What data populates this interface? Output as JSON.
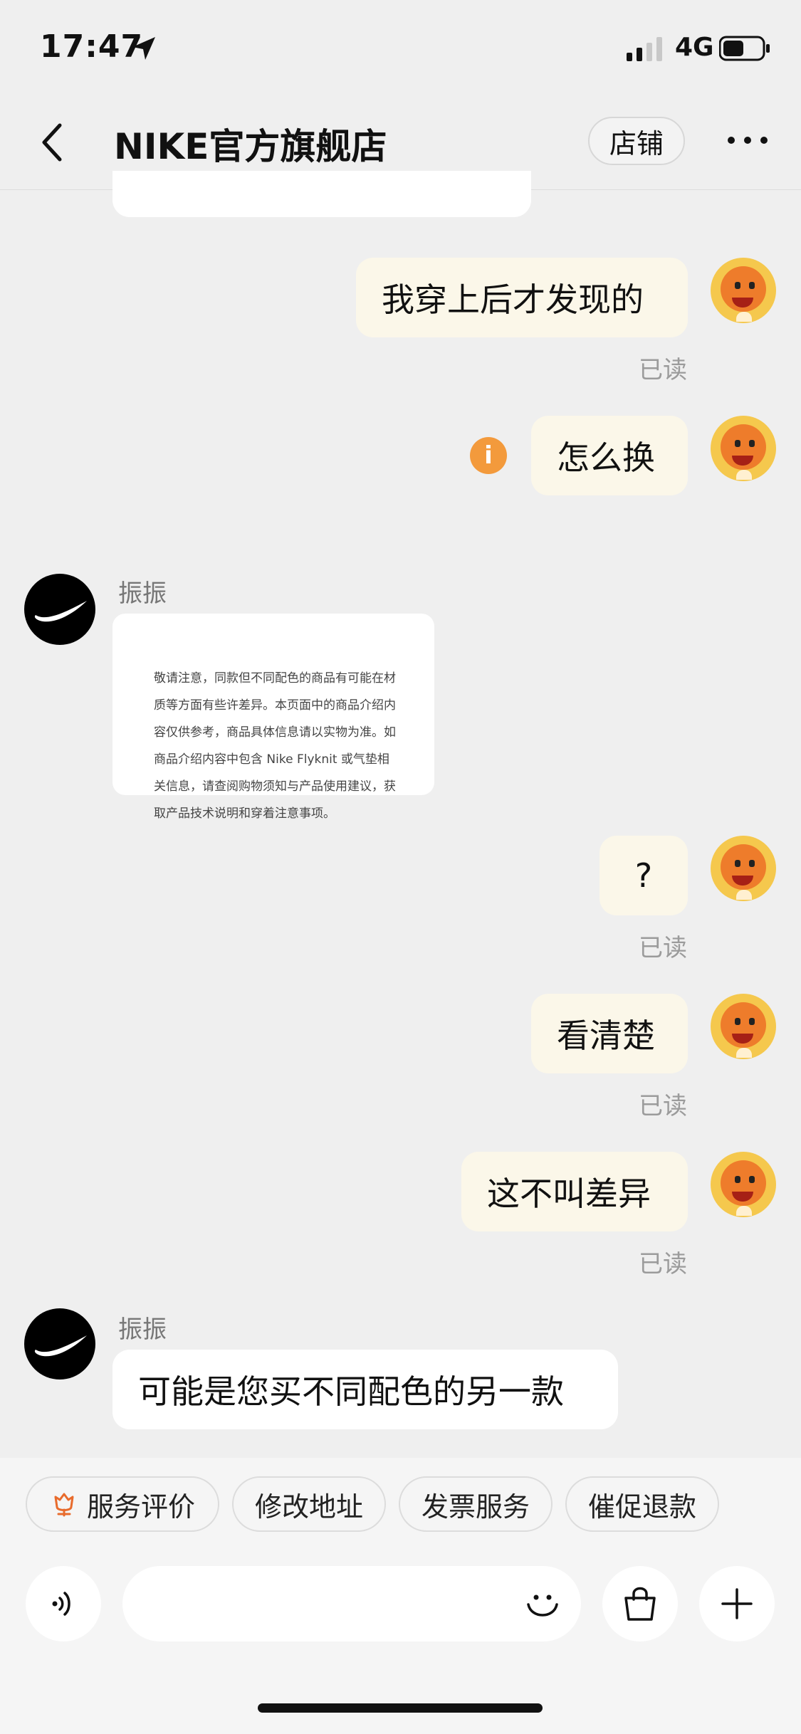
{
  "status": {
    "time": "17:47",
    "network": "4G"
  },
  "nav": {
    "title": "NIKE官方旗舰店",
    "shop_label": "店铺"
  },
  "messages": {
    "m1": "我穿上后才发现的",
    "m1_read": "已读",
    "m2": "怎么换",
    "shop_name_1": "振振",
    "notice_image_text": "敬请注意，同款但不同配色的商品有可能在材质等方面有些许差异。本页面中的商品介绍内容仅供参考，商品具体信息请以实物为准。如商品介绍内容中包含 Nike Flyknit 或气垫相关信息，请查阅购物须知与产品使用建议，获取产品技术说明和穿着注意事项。",
    "m3": "?",
    "m3_read": "已读",
    "m4": "看清楚",
    "m4_read": "已读",
    "m5": "这不叫差异",
    "m5_read": "已读",
    "shop_name_2": "振振",
    "m6": "可能是您买不同配色的另一款"
  },
  "quick_actions": [
    "服务评价",
    "修改地址",
    "发票服务",
    "催促退款"
  ],
  "colors": {
    "accent": "#f39a3c",
    "bubble_me": "#fbf7e9",
    "bubble_them": "#ffffff"
  }
}
